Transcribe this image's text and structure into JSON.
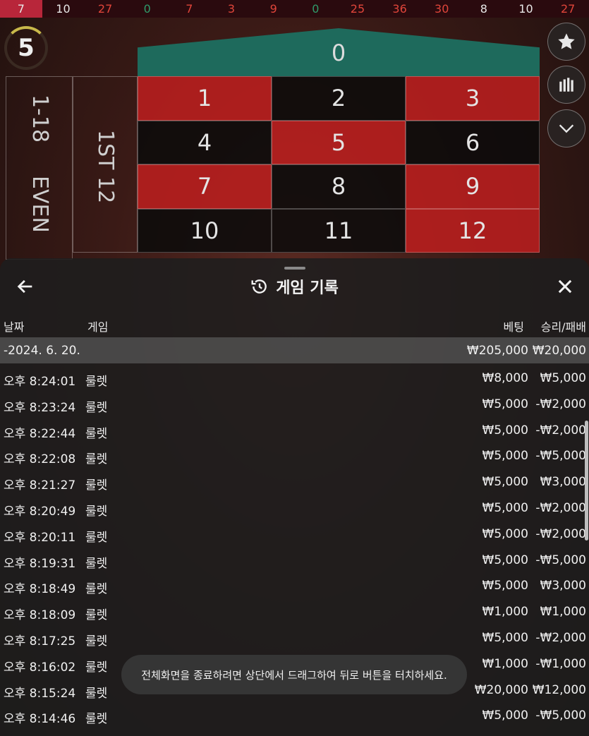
{
  "history": [
    {
      "value": "7",
      "color": "black"
    },
    {
      "value": "10",
      "color": "black"
    },
    {
      "value": "27",
      "color": "red"
    },
    {
      "value": "0",
      "color": "green"
    },
    {
      "value": "7",
      "color": "red"
    },
    {
      "value": "3",
      "color": "red"
    },
    {
      "value": "9",
      "color": "red"
    },
    {
      "value": "0",
      "color": "green"
    },
    {
      "value": "25",
      "color": "red"
    },
    {
      "value": "36",
      "color": "red"
    },
    {
      "value": "30",
      "color": "red"
    },
    {
      "value": "8",
      "color": "black"
    },
    {
      "value": "10",
      "color": "black"
    },
    {
      "value": "27",
      "color": "red"
    }
  ],
  "timer": "5",
  "table": {
    "zero": "0",
    "numbers": [
      {
        "n": "1",
        "c": "r"
      },
      {
        "n": "2",
        "c": "b"
      },
      {
        "n": "3",
        "c": "r"
      },
      {
        "n": "4",
        "c": "b"
      },
      {
        "n": "5",
        "c": "r"
      },
      {
        "n": "6",
        "c": "b"
      },
      {
        "n": "7",
        "c": "r"
      },
      {
        "n": "8",
        "c": "b"
      },
      {
        "n": "9",
        "c": "r"
      },
      {
        "n": "10",
        "c": "b"
      },
      {
        "n": "11",
        "c": "b"
      },
      {
        "n": "12",
        "c": "r"
      }
    ],
    "low_label": "1-18",
    "even_label": "EVEN",
    "dozen_label": "1ST 12"
  },
  "panel": {
    "title": "게임 기록",
    "icons": {
      "back": "arrow-left-icon",
      "history": "history-icon",
      "close": "close-icon",
      "star": "star-icon",
      "stats": "stats-icon",
      "chevron": "chevron-down-icon"
    },
    "headers": {
      "date": "날짜",
      "game": "게임",
      "bet": "베팅",
      "winloss": "승리/패배"
    },
    "date_group": {
      "date": "-2024. 6. 20.",
      "bet": "₩205,000",
      "winloss": "₩20,000"
    },
    "rows": [
      {
        "time": "오후 8:24:01",
        "game": "룰렛",
        "bet": "₩8,000",
        "winloss": "₩5,000"
      },
      {
        "time": "오후 8:23:24",
        "game": "룰렛",
        "bet": "₩5,000",
        "winloss": "-₩2,000"
      },
      {
        "time": "오후 8:22:44",
        "game": "룰렛",
        "bet": "₩5,000",
        "winloss": "-₩2,000"
      },
      {
        "time": "오후 8:22:08",
        "game": "룰렛",
        "bet": "₩5,000",
        "winloss": "-₩5,000"
      },
      {
        "time": "오후 8:21:27",
        "game": "룰렛",
        "bet": "₩5,000",
        "winloss": "₩3,000"
      },
      {
        "time": "오후 8:20:49",
        "game": "룰렛",
        "bet": "₩5,000",
        "winloss": "-₩2,000"
      },
      {
        "time": "오후 8:20:11",
        "game": "룰렛",
        "bet": "₩5,000",
        "winloss": "-₩2,000"
      },
      {
        "time": "오후 8:19:31",
        "game": "룰렛",
        "bet": "₩5,000",
        "winloss": "-₩5,000"
      },
      {
        "time": "오후 8:18:49",
        "game": "룰렛",
        "bet": "₩5,000",
        "winloss": "₩3,000"
      },
      {
        "time": "오후 8:18:09",
        "game": "룰렛",
        "bet": "₩1,000",
        "winloss": "₩1,000"
      },
      {
        "time": "오후 8:17:25",
        "game": "룰렛",
        "bet": "₩5,000",
        "winloss": "-₩2,000"
      },
      {
        "time": "오후 8:16:02",
        "game": "룰렛",
        "bet": "₩1,000",
        "winloss": "-₩1,000"
      },
      {
        "time": "오후 8:15:24",
        "game": "룰렛",
        "bet": "₩20,000",
        "winloss": "₩12,000"
      },
      {
        "time": "오후 8:14:46",
        "game": "룰렛",
        "bet": "₩5,000",
        "winloss": "-₩5,000"
      }
    ],
    "toast": "전체화면을 종료하려면 상단에서 드래그하여 뒤로 버튼을 터치하세요."
  }
}
